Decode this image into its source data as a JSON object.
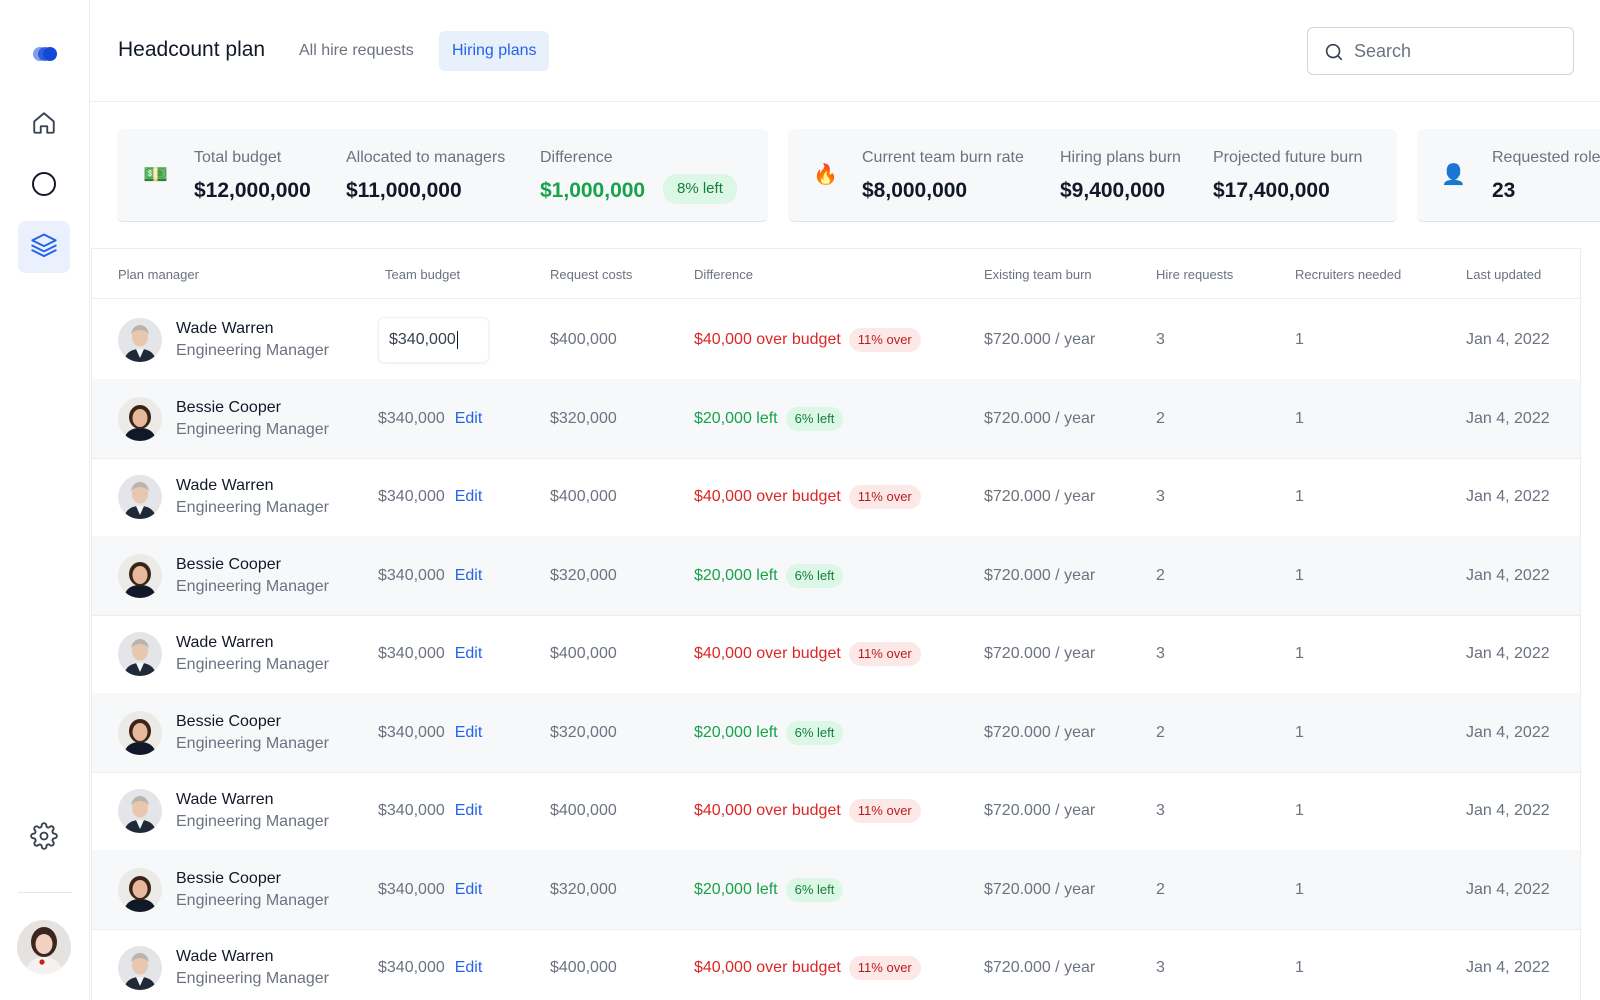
{
  "header": {
    "title": "Headcount plan",
    "tabs": [
      {
        "label": "All hire requests",
        "active": false
      },
      {
        "label": "Hiring plans",
        "active": true
      }
    ],
    "search": {
      "placeholder": "Search",
      "value": ""
    }
  },
  "sidebar": {
    "items": [
      {
        "name": "home",
        "icon": "home-icon",
        "active": false
      },
      {
        "name": "circle",
        "icon": "circle-icon",
        "active": false
      },
      {
        "name": "layers",
        "icon": "layers-icon",
        "active": true
      }
    ],
    "settings_icon": "gear-icon"
  },
  "stats": {
    "budget": {
      "icon": "💵",
      "total_label": "Total budget",
      "total_value": "$12,000,000",
      "allocated_label": "Allocated to managers",
      "allocated_value": "$11,000,000",
      "difference_label": "Difference",
      "difference_value": "$1,000,000",
      "difference_badge": "8% left"
    },
    "burn": {
      "icon": "🔥",
      "current_label": "Current team burn rate",
      "current_value": "$8,000,000",
      "hiring_label": "Hiring plans burn",
      "hiring_value": "$9,400,000",
      "projected_label": "Projected future burn",
      "projected_value": "$17,400,000"
    },
    "roles": {
      "icon": "👤",
      "requested_label": "Requested roles",
      "requested_value": "23"
    }
  },
  "table": {
    "columns": {
      "manager": "Plan manager",
      "team_budget": "Team budget",
      "request_costs": "Request costs",
      "difference": "Difference",
      "existing_burn": "Existing team burn",
      "hire_requests": "Hire requests",
      "recruiters": "Recruiters needed",
      "last_updated": "Last updated"
    },
    "edit_label": "Edit",
    "rows": [
      {
        "name": "Wade Warren",
        "role": "Engineering Manager",
        "budget": "$340,000",
        "editing": true,
        "request_costs": "$400,000",
        "difference": "$40,000 over budget",
        "status": "over",
        "badge": "11% over",
        "burn": "$720.000 / year",
        "hire_requests": "3",
        "recruiters": "1",
        "updated": "Jan 4, 2022"
      },
      {
        "name": "Bessie Cooper",
        "role": "Engineering Manager",
        "budget": "$340,000",
        "editing": false,
        "request_costs": "$320,000",
        "difference": "$20,000 left",
        "status": "left",
        "badge": "6% left",
        "burn": "$720.000 / year",
        "hire_requests": "2",
        "recruiters": "1",
        "updated": "Jan 4, 2022"
      },
      {
        "name": "Wade Warren",
        "role": "Engineering Manager",
        "budget": "$340,000",
        "editing": false,
        "request_costs": "$400,000",
        "difference": "$40,000 over budget",
        "status": "over",
        "badge": "11% over",
        "burn": "$720.000 / year",
        "hire_requests": "3",
        "recruiters": "1",
        "updated": "Jan 4, 2022"
      },
      {
        "name": "Bessie Cooper",
        "role": "Engineering Manager",
        "budget": "$340,000",
        "editing": false,
        "request_costs": "$320,000",
        "difference": "$20,000 left",
        "status": "left",
        "badge": "6% left",
        "burn": "$720.000 / year",
        "hire_requests": "2",
        "recruiters": "1",
        "updated": "Jan 4, 2022"
      },
      {
        "name": "Wade Warren",
        "role": "Engineering Manager",
        "budget": "$340,000",
        "editing": false,
        "request_costs": "$400,000",
        "difference": "$40,000 over budget",
        "status": "over",
        "badge": "11% over",
        "burn": "$720.000 / year",
        "hire_requests": "3",
        "recruiters": "1",
        "updated": "Jan 4, 2022"
      },
      {
        "name": "Bessie Cooper",
        "role": "Engineering Manager",
        "budget": "$340,000",
        "editing": false,
        "request_costs": "$320,000",
        "difference": "$20,000 left",
        "status": "left",
        "badge": "6% left",
        "burn": "$720.000 / year",
        "hire_requests": "2",
        "recruiters": "1",
        "updated": "Jan 4, 2022"
      },
      {
        "name": "Wade Warren",
        "role": "Engineering Manager",
        "budget": "$340,000",
        "editing": false,
        "request_costs": "$400,000",
        "difference": "$40,000 over budget",
        "status": "over",
        "badge": "11% over",
        "burn": "$720.000 / year",
        "hire_requests": "3",
        "recruiters": "1",
        "updated": "Jan 4, 2022"
      },
      {
        "name": "Bessie Cooper",
        "role": "Engineering Manager",
        "budget": "$340,000",
        "editing": false,
        "request_costs": "$320,000",
        "difference": "$20,000 left",
        "status": "left",
        "badge": "6% left",
        "burn": "$720.000 / year",
        "hire_requests": "2",
        "recruiters": "1",
        "updated": "Jan 4, 2022"
      },
      {
        "name": "Wade Warren",
        "role": "Engineering Manager",
        "budget": "$340,000",
        "editing": false,
        "request_costs": "$400,000",
        "difference": "$40,000 over budget",
        "status": "over",
        "badge": "11% over",
        "burn": "$720.000 / year",
        "hire_requests": "3",
        "recruiters": "1",
        "updated": "Jan 4, 2022"
      }
    ]
  },
  "colors": {
    "accent": "#2563eb",
    "accent_bg": "#e8f0fc",
    "over": "#dc2626",
    "left": "#16a34a"
  }
}
